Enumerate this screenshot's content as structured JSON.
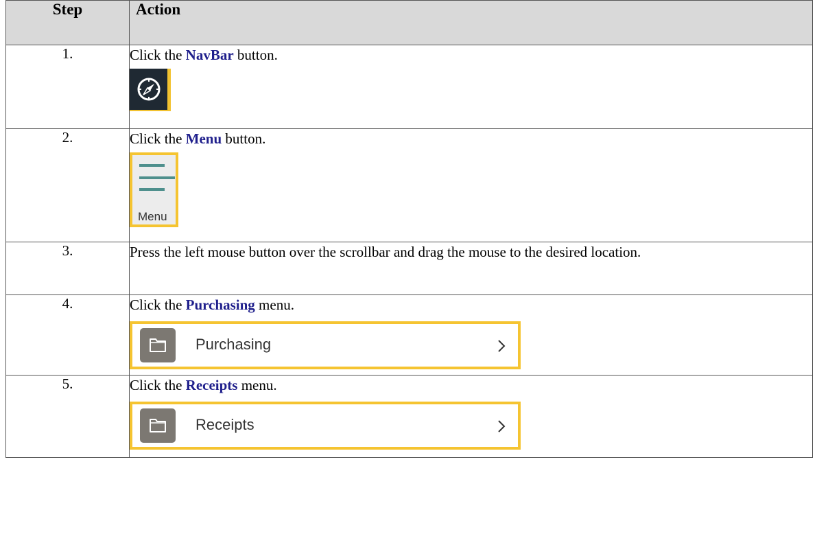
{
  "headers": {
    "step": "Step",
    "action": "Action"
  },
  "steps": [
    {
      "num": "1.",
      "text_before": "Click the ",
      "keyword": "NavBar",
      "text_after": " button.",
      "shot_icon": "compass-icon"
    },
    {
      "num": "2.",
      "text_before": "Click the ",
      "keyword": "Menu",
      "text_after": " button.",
      "shot_icon": "hamburger-menu-icon",
      "shot_label": "Menu"
    },
    {
      "num": "3.",
      "text": "Press the left mouse button over the scrollbar and drag the mouse to the desired location."
    },
    {
      "num": "4.",
      "text_before": "Click the ",
      "keyword": "Purchasing",
      "text_after": " menu.",
      "shot_icon": "folder-icon",
      "shot_label": "Purchasing"
    },
    {
      "num": "5.",
      "text_before": "Click the ",
      "keyword": "Receipts",
      "text_after": " menu.",
      "shot_icon": "folder-icon",
      "shot_label": "Receipts"
    }
  ],
  "colors": {
    "header_bg": "#d9d9d9",
    "keyword": "#1f1f8c",
    "highlight": "#f5c431",
    "menu_bars": "#4e8f8c",
    "folder_tile": "#7c7872",
    "navbar_bg": "#1f2933"
  }
}
